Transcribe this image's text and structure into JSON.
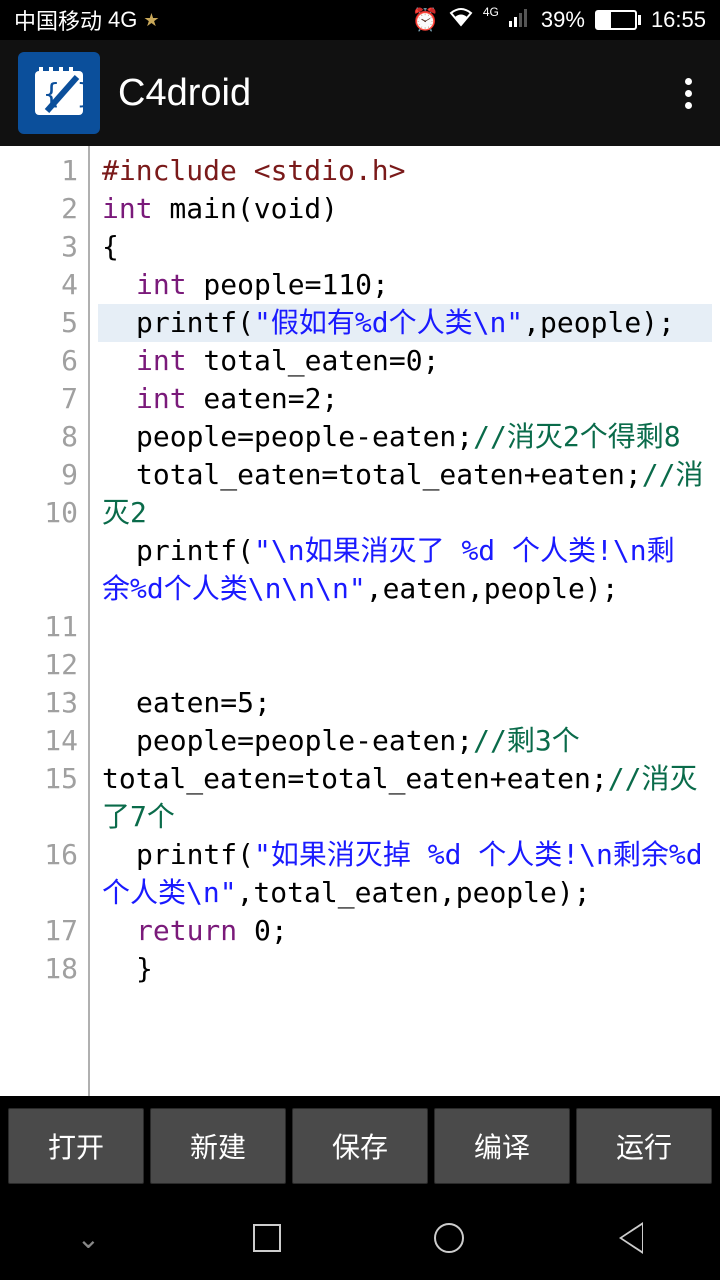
{
  "statusbar": {
    "carrier": "中国移动",
    "network": "4G",
    "signal_label": "4G",
    "battery_pct": "39%",
    "time": "16:55"
  },
  "appbar": {
    "title": "C4droid"
  },
  "code": {
    "lines": [
      {
        "n": "1",
        "pp": "#include <stdio.h>"
      },
      {
        "n": "2",
        "kw": "int",
        "rest": " main(void)"
      },
      {
        "n": "3",
        "rest": "{"
      },
      {
        "n": "4",
        "ind": 1,
        "kw": "int",
        "rest": " people=110;"
      },
      {
        "n": "5",
        "ind": 1,
        "hl": true,
        "pre": "printf(",
        "str": "\"假如有%d个人类\\n\"",
        "post": ",people);"
      },
      {
        "n": "6",
        "ind": 1,
        "kw": "int",
        "rest": " total_eaten=0;"
      },
      {
        "n": "7",
        "ind": 1,
        "kw": "int",
        "rest": " eaten=2;"
      },
      {
        "n": "8",
        "ind": 1,
        "pre": "people=people-eaten;",
        "cm": "//消灭2个得剩8"
      },
      {
        "n": "9",
        "ind": 1,
        "pre": "total_eaten=total_eaten+eaten;",
        "cm": "//消灭2"
      },
      {
        "n": "10",
        "ind": 1,
        "pre": "printf(",
        "str": "\"\\n如果消灭了 %d 个人类!\\n剩余%d个人类\\n\\n\\n\"",
        "post": ",eaten,people);"
      },
      {
        "n": "11",
        "rest": ""
      },
      {
        "n": "12",
        "rest": ""
      },
      {
        "n": "13",
        "ind": 1,
        "pre": "eaten=5;"
      },
      {
        "n": "14",
        "ind": 1,
        "pre": "people=people-eaten;",
        "cm": "//剩3个"
      },
      {
        "n": "15",
        "pre": "total_eaten=total_eaten+eaten;",
        "cm": "//消灭了7个"
      },
      {
        "n": "16",
        "ind": 1,
        "pre": "printf(",
        "str": "\"如果消灭掉 %d 个人类!\\n剩余%d个人类\\n\"",
        "post": ",total_eaten,people);"
      },
      {
        "n": "17",
        "ind": 1,
        "kw": "return",
        "rest": " 0;"
      },
      {
        "n": "18",
        "ind": 1,
        "rest": "}"
      }
    ]
  },
  "buttons": {
    "open": "打开",
    "new": "新建",
    "save": "保存",
    "compile": "编译",
    "run": "运行"
  }
}
